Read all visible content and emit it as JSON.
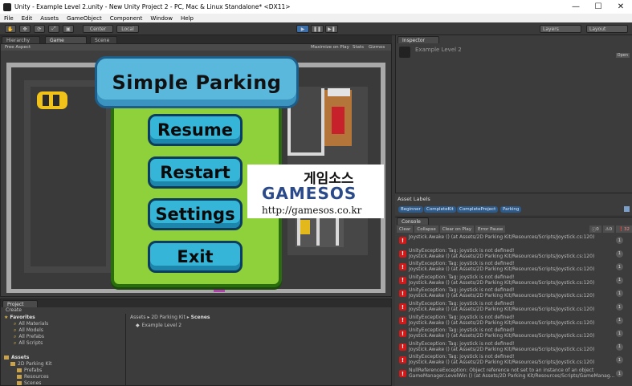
{
  "window": {
    "title": "Unity - Example Level 2.unity - New Unity Project 2 - PC, Mac & Linux Standalone* <DX11>",
    "controls": [
      "—",
      "☐",
      "✕"
    ]
  },
  "menu": [
    "File",
    "Edit",
    "Assets",
    "GameObject",
    "Component",
    "Window",
    "Help"
  ],
  "toolbar": {
    "pivot": "Center",
    "space": "Local",
    "layers": "Layers",
    "layout": "Layout"
  },
  "tabs": {
    "hierarchy": "Hierarchy",
    "game": "Game",
    "scene": "Scene",
    "inspector": "Inspector",
    "project": "Project",
    "console": "Console"
  },
  "game_view": {
    "aspect": "Free Aspect",
    "maximize": "Maximize on Play",
    "stats": "Stats",
    "gizmos": "Gizmos"
  },
  "pause_menu": {
    "title": "Simple Parking",
    "buttons": [
      "Resume",
      "Restart",
      "Settings",
      "Exit"
    ]
  },
  "watermark": {
    "korean": "게임소스",
    "brand": "GAMESOS",
    "url": "http://gamesos.co.kr"
  },
  "inspector": {
    "object_name": "Example Level 2",
    "open_label": "Open"
  },
  "asset_labels": {
    "title": "Asset Labels",
    "labels": [
      "Beginner",
      "CompleteKit",
      "CompleteProject",
      "Parking"
    ]
  },
  "console": {
    "toolbar": [
      "Clear",
      "Collapse",
      "Clear on Play",
      "Error Pause"
    ],
    "counts": {
      "log": "0",
      "warning": "0",
      "error": "32"
    },
    "entries": [
      {
        "line1": "Joystick.Awake () (at Assets/2D Parking Kit/Resources/Scripts/Joystick.cs:120)",
        "line2": "",
        "count": "1"
      },
      {
        "line1": "UnityException: Tag: joystick is not defined!",
        "line2": "Joystick.Awake () (at Assets/2D Parking Kit/Resources/Scripts/Joystick.cs:120)",
        "count": "1"
      },
      {
        "line1": "UnityException: Tag: joystick is not defined!",
        "line2": "Joystick.Awake () (at Assets/2D Parking Kit/Resources/Scripts/Joystick.cs:120)",
        "count": "1"
      },
      {
        "line1": "UnityException: Tag: joystick is not defined!",
        "line2": "Joystick.Awake () (at Assets/2D Parking Kit/Resources/Scripts/Joystick.cs:120)",
        "count": "1"
      },
      {
        "line1": "UnityException: Tag: joystick is not defined!",
        "line2": "Joystick.Awake () (at Assets/2D Parking Kit/Resources/Scripts/Joystick.cs:120)",
        "count": "1"
      },
      {
        "line1": "UnityException: Tag: joystick is not defined!",
        "line2": "Joystick.Awake () (at Assets/2D Parking Kit/Resources/Scripts/Joystick.cs:120)",
        "count": "1"
      },
      {
        "line1": "UnityException: Tag: joystick is not defined!",
        "line2": "Joystick.Awake () (at Assets/2D Parking Kit/Resources/Scripts/Joystick.cs:120)",
        "count": "1"
      },
      {
        "line1": "UnityException: Tag: joystick is not defined!",
        "line2": "Joystick.Awake () (at Assets/2D Parking Kit/Resources/Scripts/Joystick.cs:120)",
        "count": "1"
      },
      {
        "line1": "UnityException: Tag: joystick is not defined!",
        "line2": "Joystick.Awake () (at Assets/2D Parking Kit/Resources/Scripts/Joystick.cs:120)",
        "count": "1"
      },
      {
        "line1": "UnityException: Tag: joystick is not defined!",
        "line2": "Joystick.Awake () (at Assets/2D Parking Kit/Resources/Scripts/Joystick.cs:120)",
        "count": "1"
      },
      {
        "line1": "NullReferenceException: Object reference not set to an instance of an object",
        "line2": "GameManager.LevelWin () (at Assets/2D Parking Kit/Resources/Scripts/GameManag...",
        "count": "1"
      }
    ]
  },
  "project": {
    "create": "Create",
    "favorites_header": "Favorites",
    "favorites": [
      "All Materials",
      "All Models",
      "All Prefabs",
      "All Scripts"
    ],
    "assets_header": "Assets",
    "tree": [
      "2D Parking Kit",
      "Prefabs",
      "Resources",
      "Scenes"
    ],
    "breadcrumb": [
      "Assets",
      "2D Parking Kit",
      "Scenes"
    ],
    "files": [
      "Example Level 2"
    ]
  },
  "colors": {
    "board_green": "#8ed13a",
    "button_blue": "#35b6d9",
    "ribbon_blue": "#5bb8dd",
    "error_red": "#d21818"
  }
}
